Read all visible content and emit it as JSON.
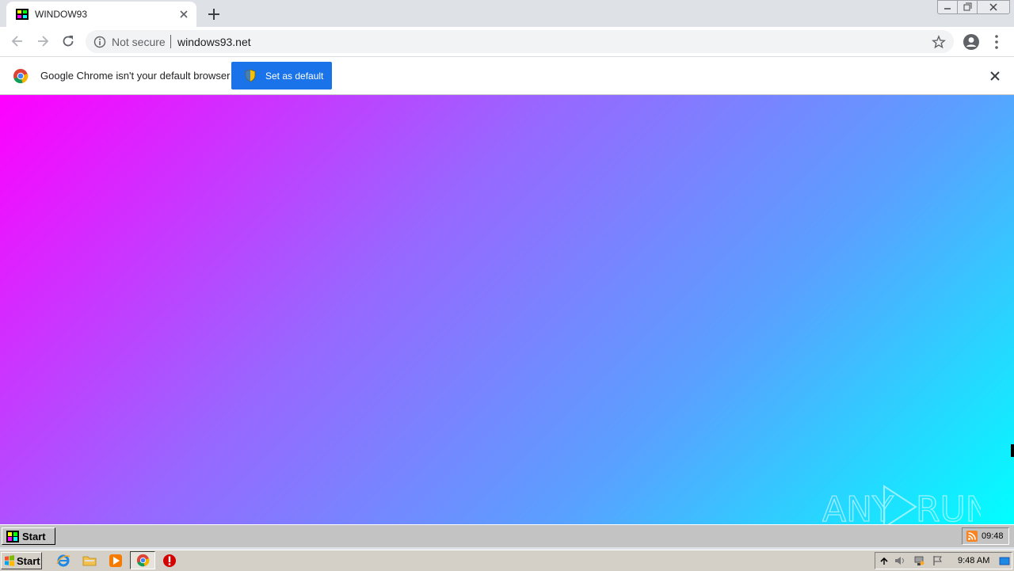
{
  "browser": {
    "tab": {
      "title": "WINDOW93"
    },
    "omnibox": {
      "security_label": "Not secure",
      "url": "windows93.net"
    },
    "infobar": {
      "message": "Google Chrome isn't your default browser",
      "button_label": "Set as default"
    }
  },
  "page": {
    "gradient_colors": [
      "#ff00ff",
      "#9966ff",
      "#5aa0ff",
      "#00ffff"
    ],
    "watermark_text": "ANY RUN",
    "w93_taskbar": {
      "start_label": "Start",
      "clock": "09:48"
    }
  },
  "os_taskbar": {
    "start_label": "Start",
    "quick_launch": [
      "ie-icon",
      "folder-icon",
      "media-player-icon",
      "chrome-icon",
      "stop-icon"
    ],
    "clock": "9:48 AM"
  },
  "colors": {
    "accent": "#1a73e8"
  }
}
